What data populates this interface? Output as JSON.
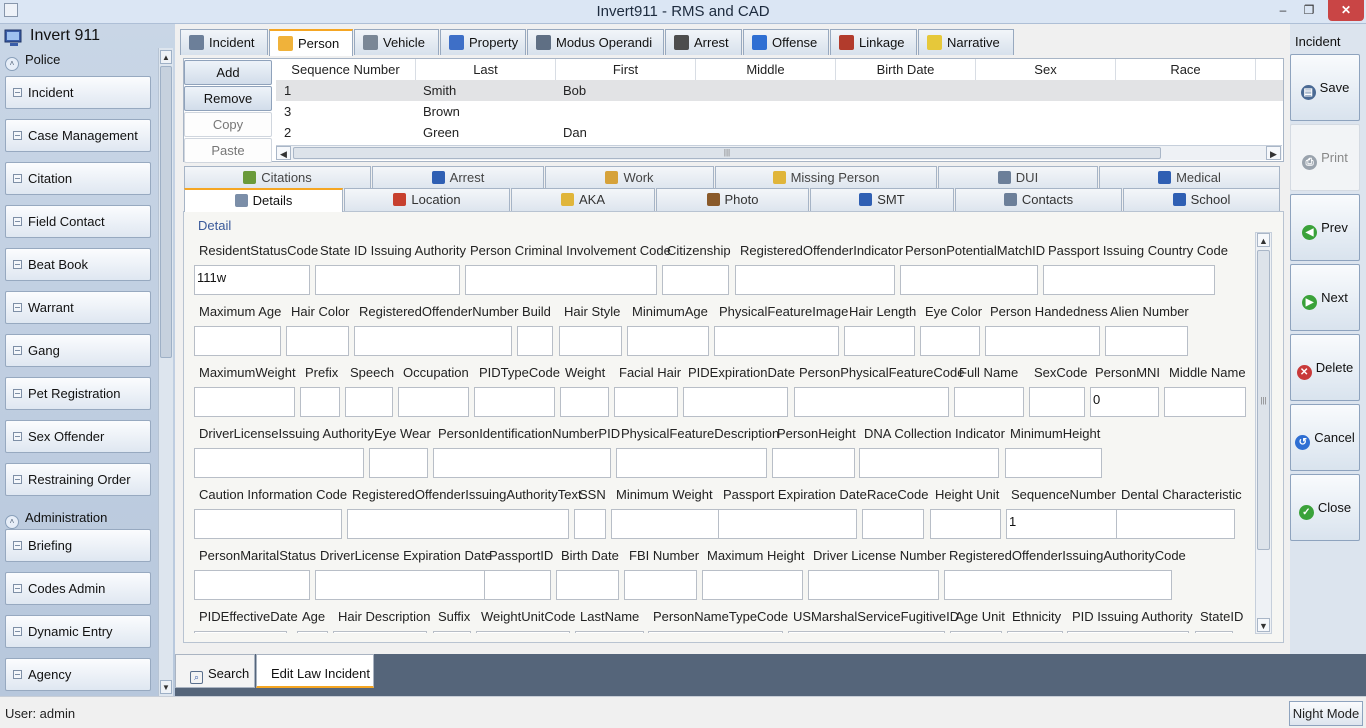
{
  "window": {
    "title": "Invert911 - RMS and CAD",
    "minimize": "‒",
    "maximize": "❐",
    "close": "✕"
  },
  "sidebar": {
    "app_title": "Invert 911",
    "sections": [
      {
        "label": "Police",
        "items": [
          "Incident",
          "Case Management",
          "Citation",
          "Field Contact",
          "Beat Book",
          "Warrant",
          "Gang",
          "Pet Registration",
          "Sex Offender",
          "Restraining Order"
        ]
      },
      {
        "label": "Administration",
        "items": [
          "Briefing",
          "Codes Admin",
          "Dynamic Entry",
          "Agency"
        ]
      }
    ]
  },
  "top_tabs": [
    {
      "label": "Incident",
      "icon": "document-icon"
    },
    {
      "label": "Person",
      "icon": "person-icon",
      "active": true
    },
    {
      "label": "Vehicle",
      "icon": "car-icon"
    },
    {
      "label": "Property",
      "icon": "cubes-icon"
    },
    {
      "label": "Modus Operandi",
      "icon": "tools-icon"
    },
    {
      "label": "Arrest",
      "icon": "officer-icon"
    },
    {
      "label": "Offense",
      "icon": "badge-icon"
    },
    {
      "label": "Linkage",
      "icon": "network-icon"
    },
    {
      "label": "Narrative",
      "icon": "notes-icon"
    }
  ],
  "list_buttons": {
    "add": "Add",
    "remove": "Remove",
    "copy": "Copy",
    "paste": "Paste"
  },
  "person_grid": {
    "columns": [
      "Sequence Number",
      "Last",
      "First",
      "Middle",
      "Birth Date",
      "Sex",
      "Race"
    ],
    "rows": [
      {
        "seq": "1",
        "last": "Smith",
        "first": "Bob"
      },
      {
        "seq": "3",
        "last": "Brown",
        "first": ""
      },
      {
        "seq": "2",
        "last": "Green",
        "first": "Dan"
      }
    ],
    "scroll_grip": "|||"
  },
  "sub_tabs_row1": [
    {
      "label": "Citations"
    },
    {
      "label": "Arrest"
    },
    {
      "label": "Work"
    },
    {
      "label": "Missing Person"
    },
    {
      "label": "DUI"
    },
    {
      "label": "Medical"
    }
  ],
  "sub_tabs_row2": [
    {
      "label": "Details",
      "active": true
    },
    {
      "label": "Location"
    },
    {
      "label": "AKA"
    },
    {
      "label": "Photo"
    },
    {
      "label": "SMT"
    },
    {
      "label": "Contacts"
    },
    {
      "label": "School"
    }
  ],
  "detail": {
    "legend": "Detail",
    "rows": [
      [
        {
          "label": "ResidentStatusCode",
          "value": "111w"
        },
        {
          "label": "State ID Issuing Authority",
          "value": ""
        },
        {
          "label": "Person Criminal Involvement Code",
          "value": ""
        },
        {
          "label": "Citizenship",
          "value": ""
        },
        {
          "label": "RegisteredOffenderIndicator",
          "value": ""
        },
        {
          "label": "PersonPotentialMatchID",
          "value": ""
        },
        {
          "label": "Passport Issuing Country Code",
          "value": ""
        }
      ],
      [
        {
          "label": "Maximum Age",
          "value": ""
        },
        {
          "label": "Hair Color",
          "value": ""
        },
        {
          "label": "RegisteredOffenderNumber",
          "value": ""
        },
        {
          "label": "Build",
          "value": ""
        },
        {
          "label": "Hair  Style",
          "value": ""
        },
        {
          "label": "MinimumAge",
          "value": ""
        },
        {
          "label": "PhysicalFeatureImage",
          "value": ""
        },
        {
          "label": "Hair Length",
          "value": ""
        },
        {
          "label": "Eye Color",
          "value": ""
        },
        {
          "label": "Person Handedness",
          "value": ""
        },
        {
          "label": "Alien Number",
          "value": ""
        }
      ],
      [
        {
          "label": "MaximumWeight",
          "value": ""
        },
        {
          "label": "Prefix",
          "value": ""
        },
        {
          "label": "Speech",
          "value": ""
        },
        {
          "label": "Occupation",
          "value": ""
        },
        {
          "label": "PIDTypeCode",
          "value": ""
        },
        {
          "label": "Weight",
          "value": ""
        },
        {
          "label": "Facial Hair",
          "value": ""
        },
        {
          "label": "PIDExpirationDate",
          "value": ""
        },
        {
          "label": "PersonPhysicalFeatureCode",
          "value": ""
        },
        {
          "label": "Full   Name",
          "value": ""
        },
        {
          "label": "SexCode",
          "value": ""
        },
        {
          "label": "PersonMNI",
          "value": "0"
        },
        {
          "label": "Middle Name",
          "value": ""
        }
      ],
      [
        {
          "label": "DriverLicenseIssuing Authority",
          "value": ""
        },
        {
          "label": "Eye Wear",
          "value": ""
        },
        {
          "label": "PersonIdentificationNumberPID",
          "value": ""
        },
        {
          "label": "PhysicalFeatureDescription",
          "value": ""
        },
        {
          "label": "PersonHeight",
          "value": ""
        },
        {
          "label": "DNA Collection Indicator",
          "value": ""
        },
        {
          "label": "MinimumHeight",
          "value": ""
        }
      ],
      [
        {
          "label": "Caution Information Code",
          "value": ""
        },
        {
          "label": "RegisteredOffenderIssuingAuthorityText",
          "value": ""
        },
        {
          "label": "SSN",
          "value": ""
        },
        {
          "label": "Minimum Weight",
          "value": ""
        },
        {
          "label": "Passport Expiration Date",
          "value": ""
        },
        {
          "label": "RaceCode",
          "value": ""
        },
        {
          "label": "Height Unit",
          "value": ""
        },
        {
          "label": "SequenceNumber",
          "value": "1"
        },
        {
          "label": "Dental Characteristic",
          "value": ""
        }
      ],
      [
        {
          "label": "PersonMaritalStatus",
          "value": ""
        },
        {
          "label": "DriverLicense Expiration Date",
          "value": ""
        },
        {
          "label": "PassportID",
          "value": ""
        },
        {
          "label": "Birth Date",
          "value": ""
        },
        {
          "label": "FBI Number",
          "value": ""
        },
        {
          "label": "Maximum Height",
          "value": ""
        },
        {
          "label": "Driver License Number",
          "value": ""
        },
        {
          "label": "RegisteredOffenderIssuingAuthorityCode",
          "value": ""
        }
      ],
      [
        {
          "label": "PIDEffectiveDate",
          "value": ""
        },
        {
          "label": "Age",
          "value": ""
        },
        {
          "label": "Hair Description",
          "value": ""
        },
        {
          "label": "Suffix",
          "value": ""
        },
        {
          "label": "WeightUnitCode",
          "value": ""
        },
        {
          "label": "LastName",
          "value": ""
        },
        {
          "label": "PersonNameTypeCode",
          "value": ""
        },
        {
          "label": "USMarshalServiceFugitiveID",
          "value": ""
        },
        {
          "label": "Age Unit",
          "value": ""
        },
        {
          "label": "Ethnicity",
          "value": ""
        },
        {
          "label": "PID Issuing Authority",
          "value": ""
        },
        {
          "label": "StateID",
          "value": ""
        }
      ]
    ]
  },
  "right_panel": {
    "title": "Incident",
    "buttons": [
      {
        "label": "Save",
        "icon": "save-icon"
      },
      {
        "label": "Print",
        "icon": "print-icon",
        "disabled": true
      },
      {
        "label": "Prev",
        "icon": "prev-icon"
      },
      {
        "label": "Next",
        "icon": "next-icon"
      },
      {
        "label": "Delete",
        "icon": "delete-icon"
      },
      {
        "label": "Cancel",
        "icon": "undo-icon"
      },
      {
        "label": "Close",
        "icon": "check-icon"
      }
    ]
  },
  "bottom_tabs": [
    {
      "label": "Search",
      "icon": "search-icon"
    },
    {
      "label": "Edit Law Incident",
      "active": true
    }
  ],
  "status": {
    "user": "User: admin",
    "night_mode": "Night Mode"
  },
  "colors": {
    "accent": "#f5a623",
    "titlebar": "#dbe6f4",
    "background": "#55657a",
    "close": "#c94545"
  }
}
